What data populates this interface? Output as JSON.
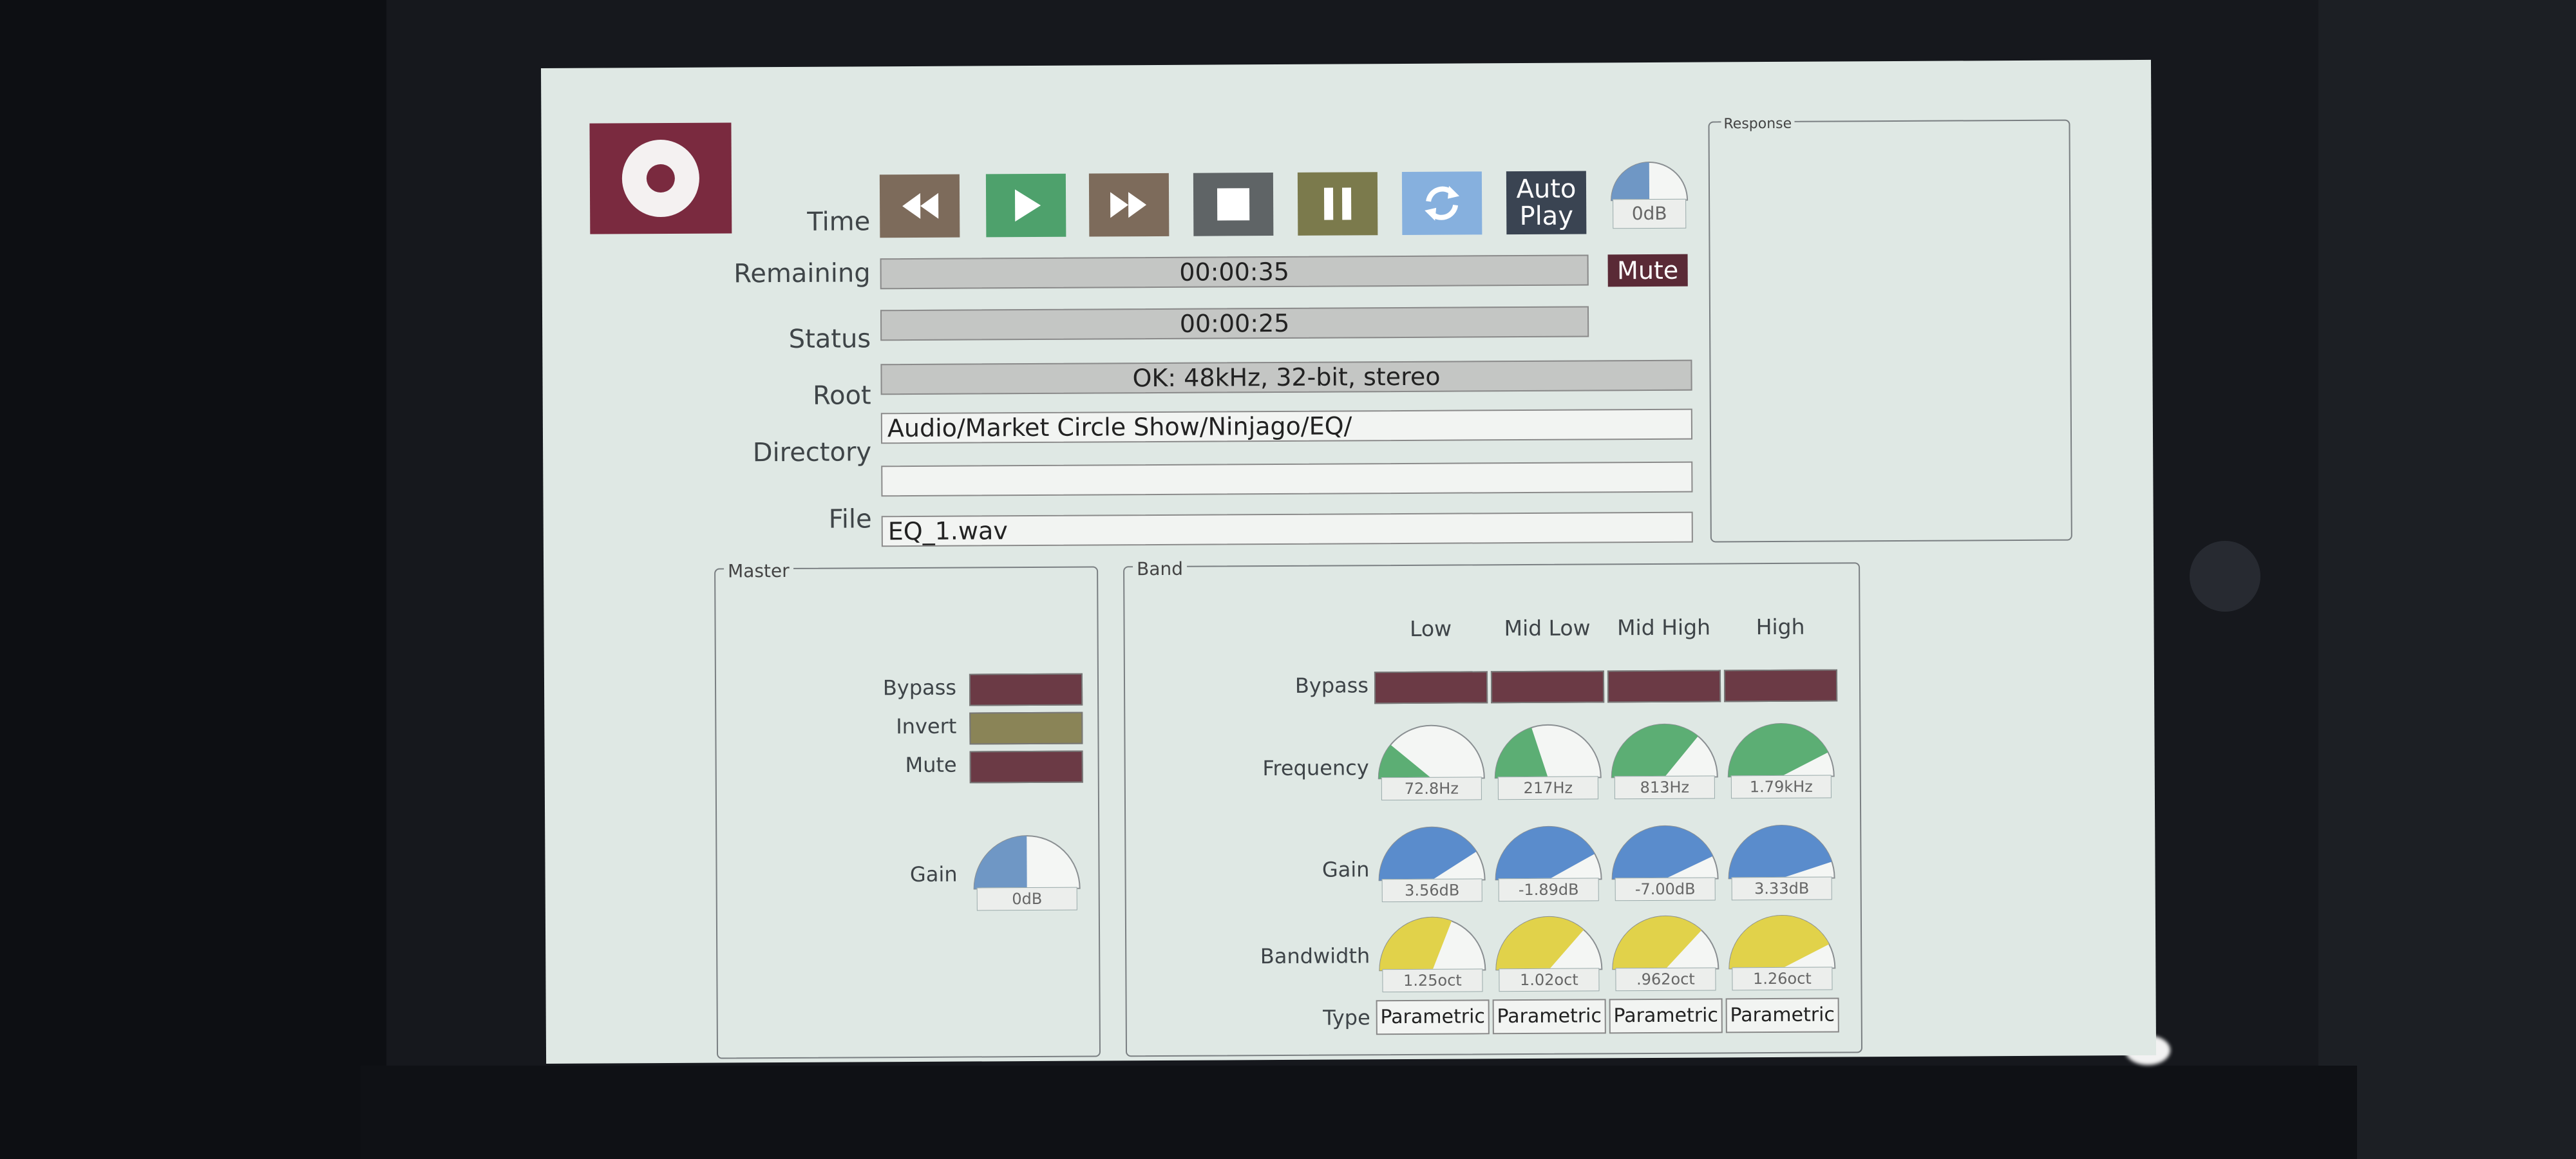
{
  "transport": {
    "time_label": "Time",
    "remaining_label": "Remaining",
    "status_label": "Status",
    "root_label": "Root",
    "directory_label": "Directory",
    "file_label": "File",
    "auto_play": [
      "Auto",
      "Play"
    ],
    "mute": "Mute",
    "output_level": "0dB",
    "time_value": "00:00:35",
    "remaining_value": "00:00:25",
    "status_value": "OK: 48kHz, 32-bit, stereo",
    "root_value": "Audio/Market Circle Show/Ninjago/EQ/",
    "directory_value": "",
    "file_value": "EQ_1.wav",
    "icons": [
      "rewind-icon",
      "play-icon",
      "fast-forward-icon",
      "stop-icon",
      "pause-icon",
      "loop-icon"
    ]
  },
  "response": {
    "title": "Response"
  },
  "master": {
    "title": "Master",
    "bypass_label": "Bypass",
    "invert_label": "Invert",
    "mute_label": "Mute",
    "gain_label": "Gain",
    "gain_value": "0dB",
    "gain_level": 0.5
  },
  "band": {
    "title": "Band",
    "columns": [
      "Low",
      "Mid Low",
      "Mid High",
      "High"
    ],
    "row_labels": {
      "bypass": "Bypass",
      "frequency": "Frequency",
      "gain": "Gain",
      "bandwidth": "Bandwidth",
      "type": "Type"
    },
    "frequency": [
      "72.8Hz",
      "217Hz",
      "813Hz",
      "1.79kHz"
    ],
    "frequency_level": [
      0.22,
      0.4,
      0.72,
      0.85
    ],
    "gain": [
      "3.56dB",
      "-1.89dB",
      "-7.00dB",
      "3.33dB"
    ],
    "gain_level": [
      0.82,
      0.84,
      0.86,
      0.9
    ],
    "bandwidth": [
      "1.25oct",
      "1.02oct",
      ".962oct",
      "1.26oct"
    ],
    "bandwidth_level": [
      0.62,
      0.73,
      0.74,
      0.85
    ],
    "type": [
      "Parametric",
      "Parametric",
      "Parametric",
      "Parametric"
    ]
  },
  "colors": {
    "logo": "#7a2a3f",
    "rewind": "#7d6b5b",
    "play": "#4ea16c",
    "fast_forward": "#7d6b5b",
    "stop": "#5f6466",
    "pause": "#7b7a4c",
    "loop": "#86b0de",
    "auto_play": "#3a4452",
    "mute": "#5a2a36",
    "bypass_off": "#6b3a45",
    "invert_off": "#8a8457",
    "frequency_knob": "#5cae74",
    "gain_knob": "#5a8ccc",
    "bandwidth_knob": "#e1d24a",
    "output_knob": "#6f97c5"
  }
}
